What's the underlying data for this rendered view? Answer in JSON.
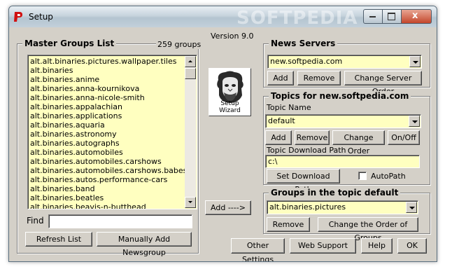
{
  "window": {
    "title": "Setup",
    "watermark": "SOFTPEDIA",
    "close_glyph": "x",
    "icons": [
      "app-icon",
      "minimize-icon",
      "maximize-icon",
      "close-icon"
    ]
  },
  "version": "Version 9.0",
  "master_groups": {
    "title": "Master Groups List",
    "count": "259 groups",
    "items": [
      "alt.alt.binaries.pictures.wallpaper.tiles",
      "alt.binaries",
      "alt.binaries.anime",
      "alt.binaries.anna-kournikova",
      "alt.binaries.anna-nicole-smith",
      "alt.binaries.appalachian",
      "alt.binaries.applications",
      "alt.binaries.aquaria",
      "alt.binaries.astronomy",
      "alt.binaries.autographs",
      "alt.binaries.automobiles",
      "alt.binaries.automobiles.carshows",
      "alt.binaries.automobiles.carshows.babes",
      "alt.binaries.autos.performance-cars",
      "alt.binaries.band",
      "alt.binaries.beatles",
      "alt.binaries.beavis-n-butthead"
    ],
    "find_label": "Find",
    "find_value": "",
    "refresh_label": "Refresh List",
    "manual_add_label": "Manually Add Newsgroup"
  },
  "wizard": {
    "label": "Setup Wizard"
  },
  "add_arrow_label": "Add      ---->",
  "news_servers": {
    "title": "News Servers",
    "selected": "new.softpedia.com",
    "add_label": "Add",
    "remove_label": "Remove",
    "change_order_label": "Change Server Order"
  },
  "topics": {
    "title": "Topics for new.softpedia.com",
    "topic_name_label": "Topic Name",
    "topic_selected": "default",
    "add_label": "Add",
    "remove_label": "Remove",
    "change_order_label": "Change Order",
    "onoff_label": "On/Off",
    "download_path_label": "Topic Download Path",
    "download_path_value": "c:\\",
    "set_path_label": "Set Download Path",
    "autopath_label": "AutoPath"
  },
  "groups_in_topic": {
    "title": "Groups in the topic default",
    "selected": "alt.binaries.pictures",
    "remove_label": "Remove",
    "change_order_label": "Change the Order of Groups"
  },
  "footer": {
    "other_settings": "Other Settings",
    "web_support": "Web Support",
    "help": "Help",
    "ok": "OK"
  },
  "colors": {
    "field_bg": "#ffffc0",
    "dialog_bg": "#d4d0c8",
    "app_icon_red": "#d01010"
  }
}
